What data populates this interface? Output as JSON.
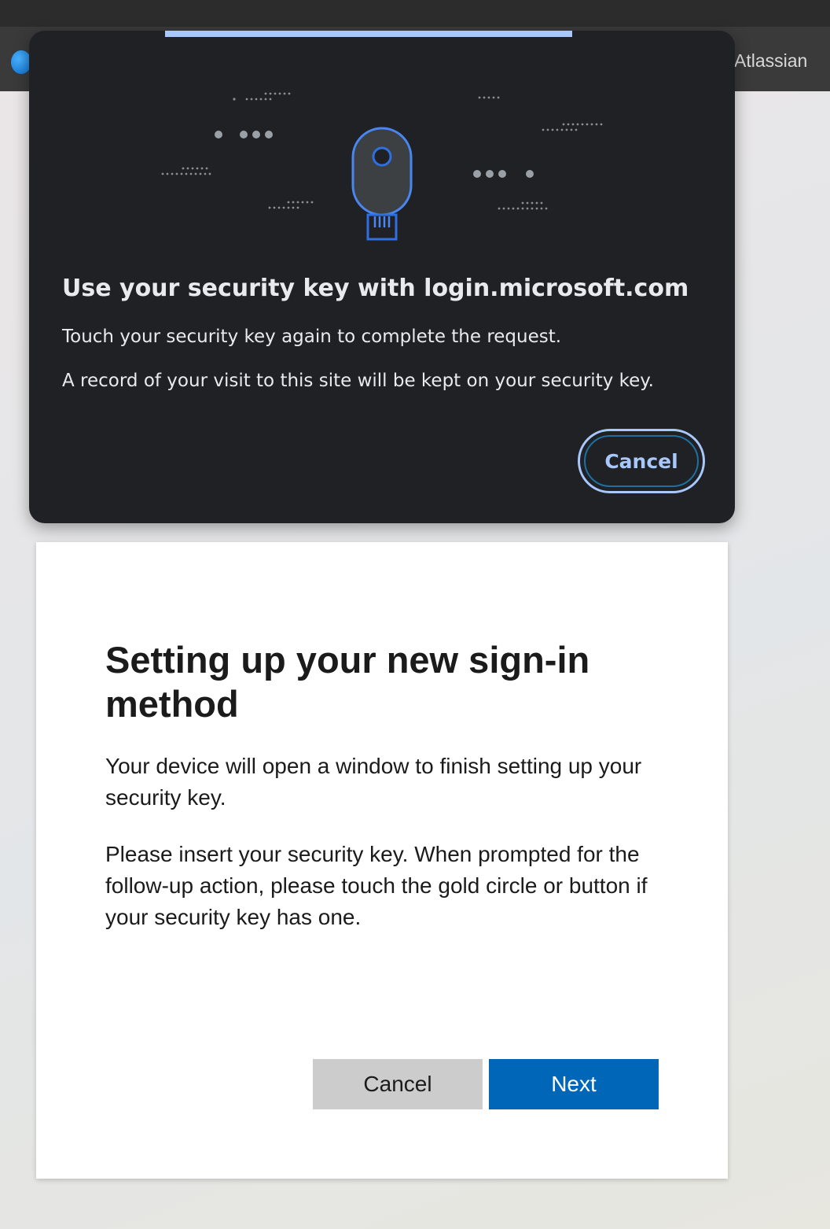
{
  "browser": {
    "bookmark_label": "Atlassian"
  },
  "security_key_dialog": {
    "title": "Use your security key with login.microsoft.com",
    "instruction": "Touch your security key again to complete the request.",
    "notice": "A record of your visit to this site will be kept on your security key.",
    "cancel_label": "Cancel",
    "accent_color": "#a8c7fa",
    "key_icon_color": "#4a86f0"
  },
  "signin_card": {
    "title": "Setting up your new sign-in method",
    "paragraph_1": "Your device will open a window to finish setting up your security key.",
    "paragraph_2": "Please insert your security key. When prompted for the follow-up action, please touch the gold circle or button if your security key has one.",
    "cancel_label": "Cancel",
    "next_label": "Next",
    "primary_color": "#0067b8"
  }
}
